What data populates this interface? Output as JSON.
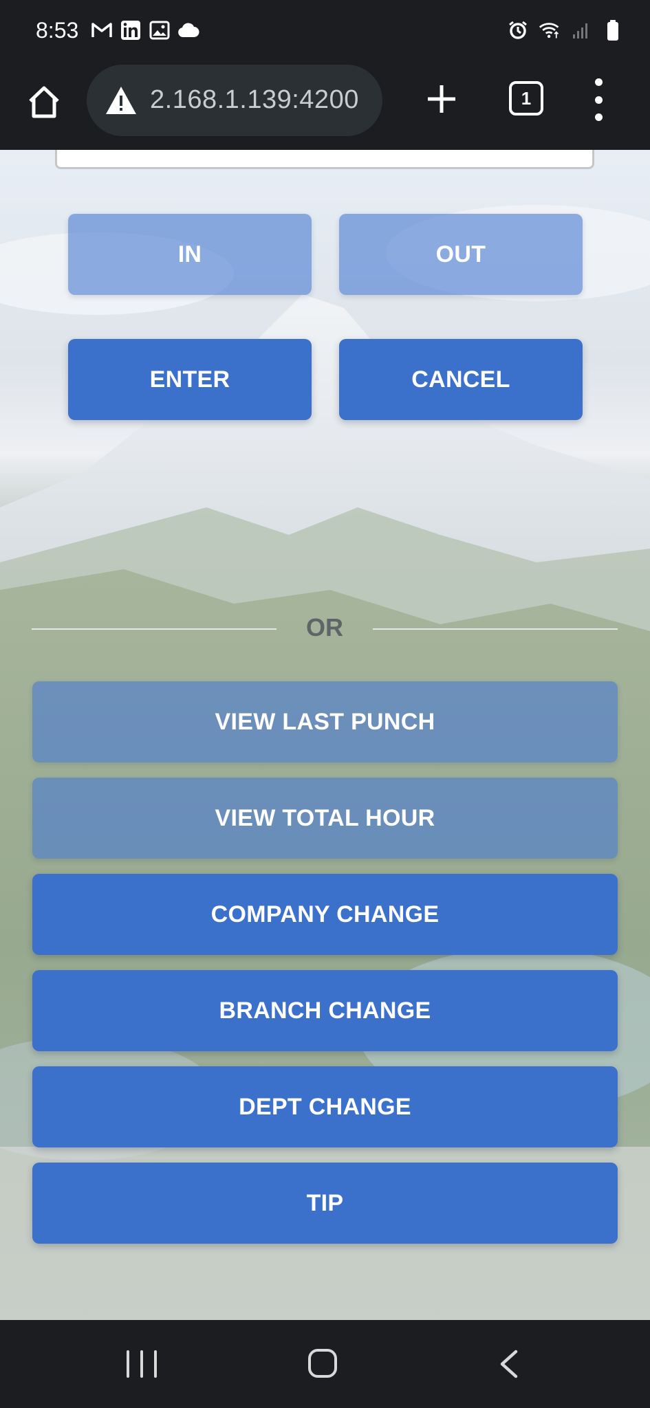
{
  "status_bar": {
    "time": "8:53",
    "left_icons": [
      "gmail-icon",
      "linkedin-icon",
      "gallery-icon",
      "cloud-icon"
    ],
    "right_icons": [
      "alarm-icon",
      "wifi-icon",
      "signal-icon",
      "battery-icon"
    ]
  },
  "browser": {
    "url": "2.168.1.139:4200",
    "tab_count": "1",
    "icons": {
      "home": "home-icon",
      "warning": "warning-icon",
      "new_tab": "plus-icon",
      "menu": "more-vert-icon"
    }
  },
  "punch": {
    "in_label": "IN",
    "out_label": "OUT",
    "enter_label": "ENTER",
    "cancel_label": "CANCEL",
    "divider_label": "OR"
  },
  "actions": [
    {
      "label": "VIEW LAST PUNCH",
      "state": "faded"
    },
    {
      "label": "VIEW TOTAL HOUR",
      "state": "faded"
    },
    {
      "label": "COMPANY CHANGE",
      "state": "active"
    },
    {
      "label": "BRANCH CHANGE",
      "state": "active"
    },
    {
      "label": "DEPT CHANGE",
      "state": "active"
    },
    {
      "label": "TIP",
      "state": "active"
    }
  ],
  "colors": {
    "primary": "#3b70cb",
    "primary_faded": "#7aa0dc",
    "system_bar": "#1b1d20"
  },
  "nav_bar": {
    "icons": [
      "recent-apps-icon",
      "home-icon",
      "back-icon"
    ]
  }
}
